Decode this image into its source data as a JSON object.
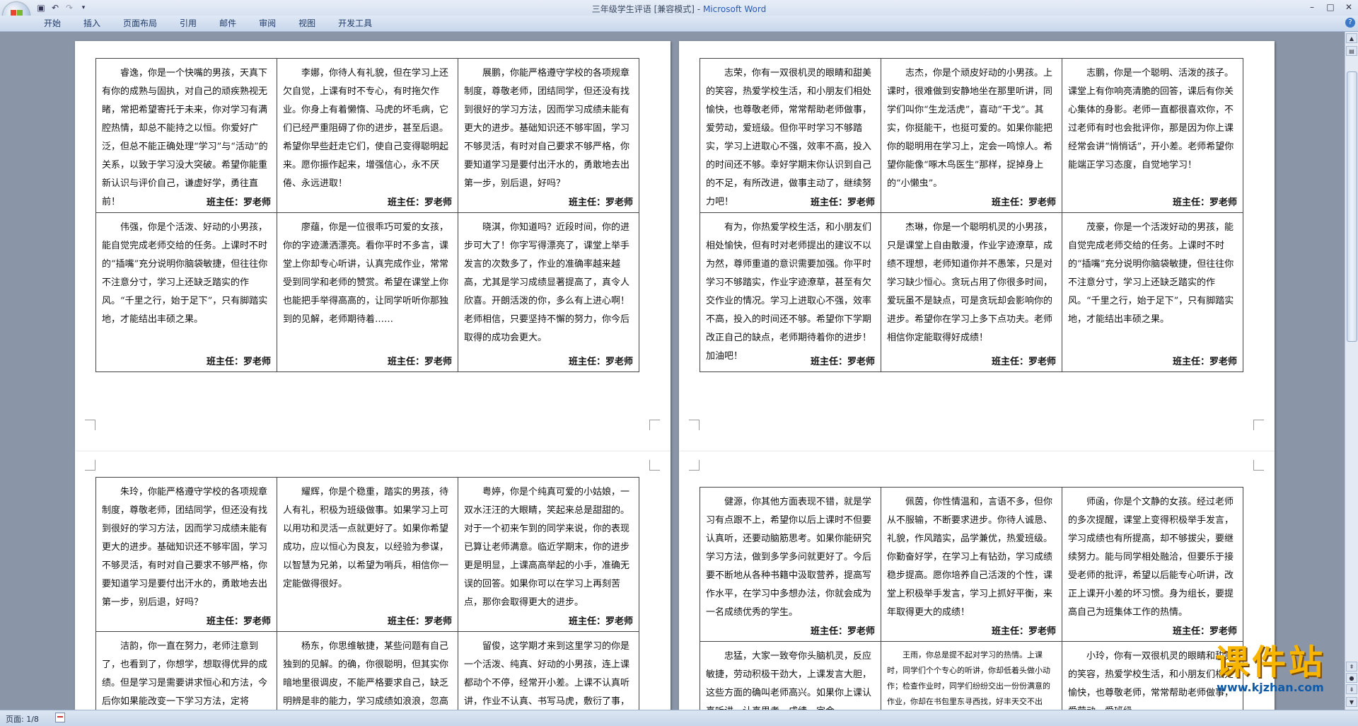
{
  "window": {
    "title": "三年级学生评语 [兼容模式]",
    "app_name": "Microsoft Word",
    "title_separator": " - "
  },
  "quick_access": [
    "save-icon",
    "undo-icon",
    "redo-icon",
    "customize-icon"
  ],
  "ribbon": {
    "tabs": [
      "开始",
      "插入",
      "页面布局",
      "引用",
      "邮件",
      "审阅",
      "视图",
      "开发工具"
    ]
  },
  "status": {
    "page": "页面: 1/8"
  },
  "watermark": {
    "text": "课件站",
    "url": "www.kjzhan.com"
  },
  "pages": [
    {
      "rows": [
        [
          {
            "text": "睿逸，你是一个快嘴的男孩，天真下有你的成熟与固执，对自己的顽疾熟视无睹，常把希望寄托于未来，你对学习有满腔热情，却总不能持之以恒。你爱好广泛，但总不能正确处理“学习”与“活动”的关系，以致于学习没大突破。希望你能重新认识与评价自己，谦虚好学，勇往直前！",
            "sign": "班主任：罗老师"
          },
          {
            "text": "李娜，你待人有礼貌，但在学习上还欠自觉，上课有时不专心，有时拖欠作业。你身上有着懒惰、马虎的坏毛病，它们已经严重阻碍了你的进步，甚至后退。希望你早些赶走它们，使自己变得聪明起来。愿你振作起来，增强信心，永不厌倦、永远进取！",
            "sign": "班主任：罗老师"
          },
          {
            "text": "展鹏，你能严格遵守学校的各项规章制度，尊敬老师，团结同学，但还没有找到很好的学习方法，因而学习成绩未能有更大的进步。基础知识还不够牢固，学习不够灵活，有时对自己要求不够严格，你要知道学习是要付出汗水的，勇敢地去出第一步，别后退，好吗？",
            "sign": "班主任：罗老师"
          }
        ],
        [
          {
            "text": "伟强，你是个活泼、好动的小男孩，能自觉完成老师交给的任务。上课时不时的“插嘴”充分说明你脑袋敏捷，但往往你不注意分寸，学习上还缺乏踏实的作风。“千里之行，始于足下”，只有脚踏实地，才能结出丰硕之果。",
            "sign": "班主任：罗老师"
          },
          {
            "text": "廖蕴，你是一位很乖巧可爱的女孩，你的字迹潇洒漂亮。看你平时不多言，课堂上你却专心听讲，认真完成作业，常常受到同学和老师的赞赏。希望在课堂上你也能把手举得高高的，让同学听听你那独到的见解，老师期待着……",
            "sign": "班主任：罗老师"
          },
          {
            "text": "晓淇，你知道吗？近段时间，你的进步可大了！你字写得漂亮了，课堂上举手发言的次数多了，作业的准确率越来越高，尤其是学习成绩显著提高了，真令人欣喜。开朗活泼的你，多么有上进心啊！老师相信，只要坚持不懈的努力，你今后取得的成功会更大。",
            "sign": "班主任：罗老师"
          }
        ]
      ]
    },
    {
      "rows": [
        [
          {
            "text": "志荣，你有一双很机灵的眼睛和甜美的笑容，热爱学校生活，和小朋友们相处愉快，也尊敬老师，常常帮助老师做事，爱劳动，爱班级。但你平时学习不够踏实，学习上进取心不强，效率不高，投入的时间还不够。幸好学期末你认识到自己的不足，有所改进，做事主动了，继续努力吧！",
            "sign": "班主任：罗老师"
          },
          {
            "text": "志杰，你是个顽皮好动的小男孩。上课时，很难做到安静地坐在那里听讲，同学们叫你“生龙活虎”，喜动“干戈”。其实，你挺能干，也挺可爱的。如果你能把你的聪明用在学习上，定会一鸣惊人。希望你能像“啄木鸟医生”那样，捉掉身上的“小懒虫”。",
            "sign": "班主任：罗老师"
          },
          {
            "text": "志鹏，你是一个聪明、活泼的孩子。课堂上有你响亮清脆的回答，课后有你关心集体的身影。老师一直都很喜欢你，不过老师有时也会批评你，那是因为你上课经常会讲“悄悄话”，开小差。老师希望你能端正学习态度，自觉地学习！",
            "sign": "班主任：罗老师"
          }
        ],
        [
          {
            "text": "有为，你热爱学校生活，和小朋友们相处愉快，但有时对老师提出的建议不以为然，尊师重道的意识需要加强。你平时学习不够踏实，作业字迹潦草，甚至有欠交作业的情况。学习上进取心不强，效率不高，投入的时间还不够。希望你下学期改正自己的缺点，老师期待着你的进步！加油吧！",
            "sign": "班主任：罗老师"
          },
          {
            "text": "杰琳，你是一个聪明机灵的小男孩，只是课堂上自由散漫，作业字迹潦草，成绩不理想，老师知道你并不愚笨，只是对学习缺少恒心。贪玩占用了你很多时间，爱玩虽不是缺点，可是贪玩却会影响你的进步。希望你在学习上多下点功夫。老师相信你定能取得好成绩！",
            "sign": "班主任：罗老师"
          },
          {
            "text": "茂豪，你是一个活泼好动的男孩，能自觉完成老师交给的任务。上课时不时的“插嘴”充分说明你脑袋敏捷，但往往你不注意分寸，学习上还缺乏踏实的作风。“千里之行，始于足下”，只有脚踏实地，才能结出丰硕之果。",
            "sign": "班主任：罗老师"
          }
        ]
      ]
    },
    {
      "rows": [
        [
          {
            "text": "朱玲，你能严格遵守学校的各项规章制度，尊敬老师，团结同学，但还没有找到很好的学习方法，因而学习成绩未能有更大的进步。基础知识还不够牢固，学习不够灵活，有时对自己要求不够严格，你要知道学习是要付出汗水的，勇敢地去出第一步，别后退，好吗？",
            "sign": "班主任：罗老师"
          },
          {
            "text": "耀辉，你是个稳重，踏实的男孩，待人有礼，积极为班级做事。如果学习上可以用功和灵活一点就更好了。如果你希望成功，应以恒心为良友，以经验为参谋，以智慧为兄弟，以希望为哨兵，相信你一定能做得很好。",
            "sign": "班主任：罗老师"
          },
          {
            "text": "粤婷，你是个纯真可爱的小姑娘，一双水汪汪的大眼睛，笑起来总是甜甜的。对于一个初来乍到的同学来说，你的表现已算让老师满意。临近学期末，你的进步更是明显，上课高高举起的小手，准确无误的回答。如果你可以在学习上再刻苦点，那你会取得更大的进步。",
            "sign": "班主任：罗老师"
          }
        ],
        [
          {
            "text": "洁韵，你一直在努力，老师注意到了，也看到了，你想学，想取得优异的成绩。但是学习是需要讲求恒心和方法，今后你如果能改变一下学习方法，定将",
            "sign": ""
          },
          {
            "text": "杨东，你思维敏捷，某些问题有自己独到的见解。的确，你很聪明，但其实你暗地里很调皮，不能严格要求自己，缺乏明辨是非的能力，学习成绩如浪浪，忽高忽低。俗话说：吃得苦中苦，方为",
            "sign": ""
          },
          {
            "text": "留俊，这学期才来到这里学习的你是一个活泼、纯真、好动的小男孩，连上课都动个不停，经常开小差。上课不认真听讲，作业不认真、书写马虎，敷衍了事，导致学习成绩不理想，请你下",
            "sign": ""
          }
        ]
      ]
    },
    {
      "rows": [
        [
          {
            "text": "健源，你其他方面表现不错，就是学习有点跟不上，希望你以后上课时不但要认真听，还要动脑筋思考。如果你能研究学习方法，做到多学多问就更好了。今后要不断地从各种书籍中汲取营养，提高写作水平，在学习中多想办法，你就会成为一名成绩优秀的学生。",
            "sign": "班主任：罗老师"
          },
          {
            "text": "佩茵，你性情温和，言语不多，但你从不服输，不断要求进步。你待人诚恳、礼貌，作风踏实，品学兼优，热爱班级。你勤奋好学，在学习上有钻劲，学习成绩稳步提高。愿你培养自己活泼的个性，课堂上积极举手发言，学习上抓好平衡，来年取得更大的成绩！",
            "sign": "班主任：罗老师"
          },
          {
            "text": "师函，你是个文静的女孩。经过老师的多次提醒，课堂上变得积极举手发言，学习成绩也有所提高，却不够拔尖，要继续努力。能与同学相处融洽，但要乐于接受老师的批评，希望以后能专心听讲，改正上课开小差的坏习惯。身为组长，要提高自己为班集体工作的热情。",
            "sign": "班主任：罗老师"
          }
        ],
        [
          {
            "text": "忠猛，大家一致夸你头脑机灵，反应敏捷，劳动积极干劲大，上课发言大胆，这些方面的确叫老师高兴。如果你上课认真听讲，认真思考，成绩一定会",
            "sign": ""
          },
          {
            "text": "王雨，你总是提不起对学习的热情。上课时，同学们个个专心的听讲，你却低着头做小动作；检查作业时，同学们纷纷交出一份份满意的作业，你却在书包里东寻西找，好丰天交不出来。请你明白，老师一直在关注你的点滴进步",
            "sign": ""
          },
          {
            "text": "小玲，你有一双很机灵的眼睛和甜美的笑容，热爱学校生活，和小朋友们相处愉快，也尊敬老师，常常帮助老师做事，爱劳动，爱班级。",
            "sign": ""
          }
        ]
      ]
    }
  ]
}
